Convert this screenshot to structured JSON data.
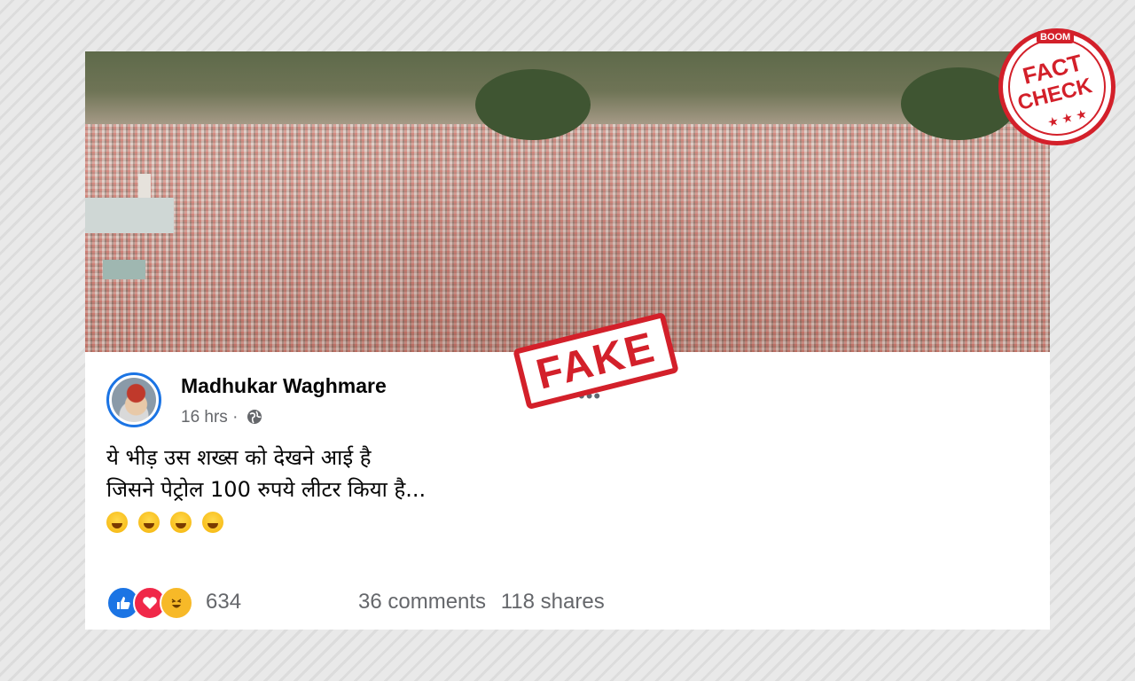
{
  "post": {
    "author": "Madhukar Waghmare",
    "time": "16 hrs",
    "separator": "·",
    "text_line1": "ये भीड़ उस शख्स को देखने आई है",
    "text_line2": "जिसने पेट्रोल 100 रुपये लीटर किया है...",
    "more_options": "•••",
    "reaction_count": "634",
    "comments": "36 comments",
    "shares": "118 shares"
  },
  "overlays": {
    "stamp": "FAKE",
    "badge_brand": "BOOM",
    "badge_line1": "FACT",
    "badge_line2": "CHECK",
    "badge_stars": "★ ★ ★"
  },
  "icons": {
    "privacy": "globe-icon",
    "reactions": [
      "like-icon",
      "love-icon",
      "haha-icon"
    ],
    "emojis": [
      "grinning-emoji",
      "beaming-emoji",
      "tears-of-joy-emoji",
      "rolling-laughing-emoji"
    ]
  },
  "colors": {
    "accent": "#1b74e4",
    "stamp_red": "#d3202a",
    "secondary_text": "#65676b"
  }
}
